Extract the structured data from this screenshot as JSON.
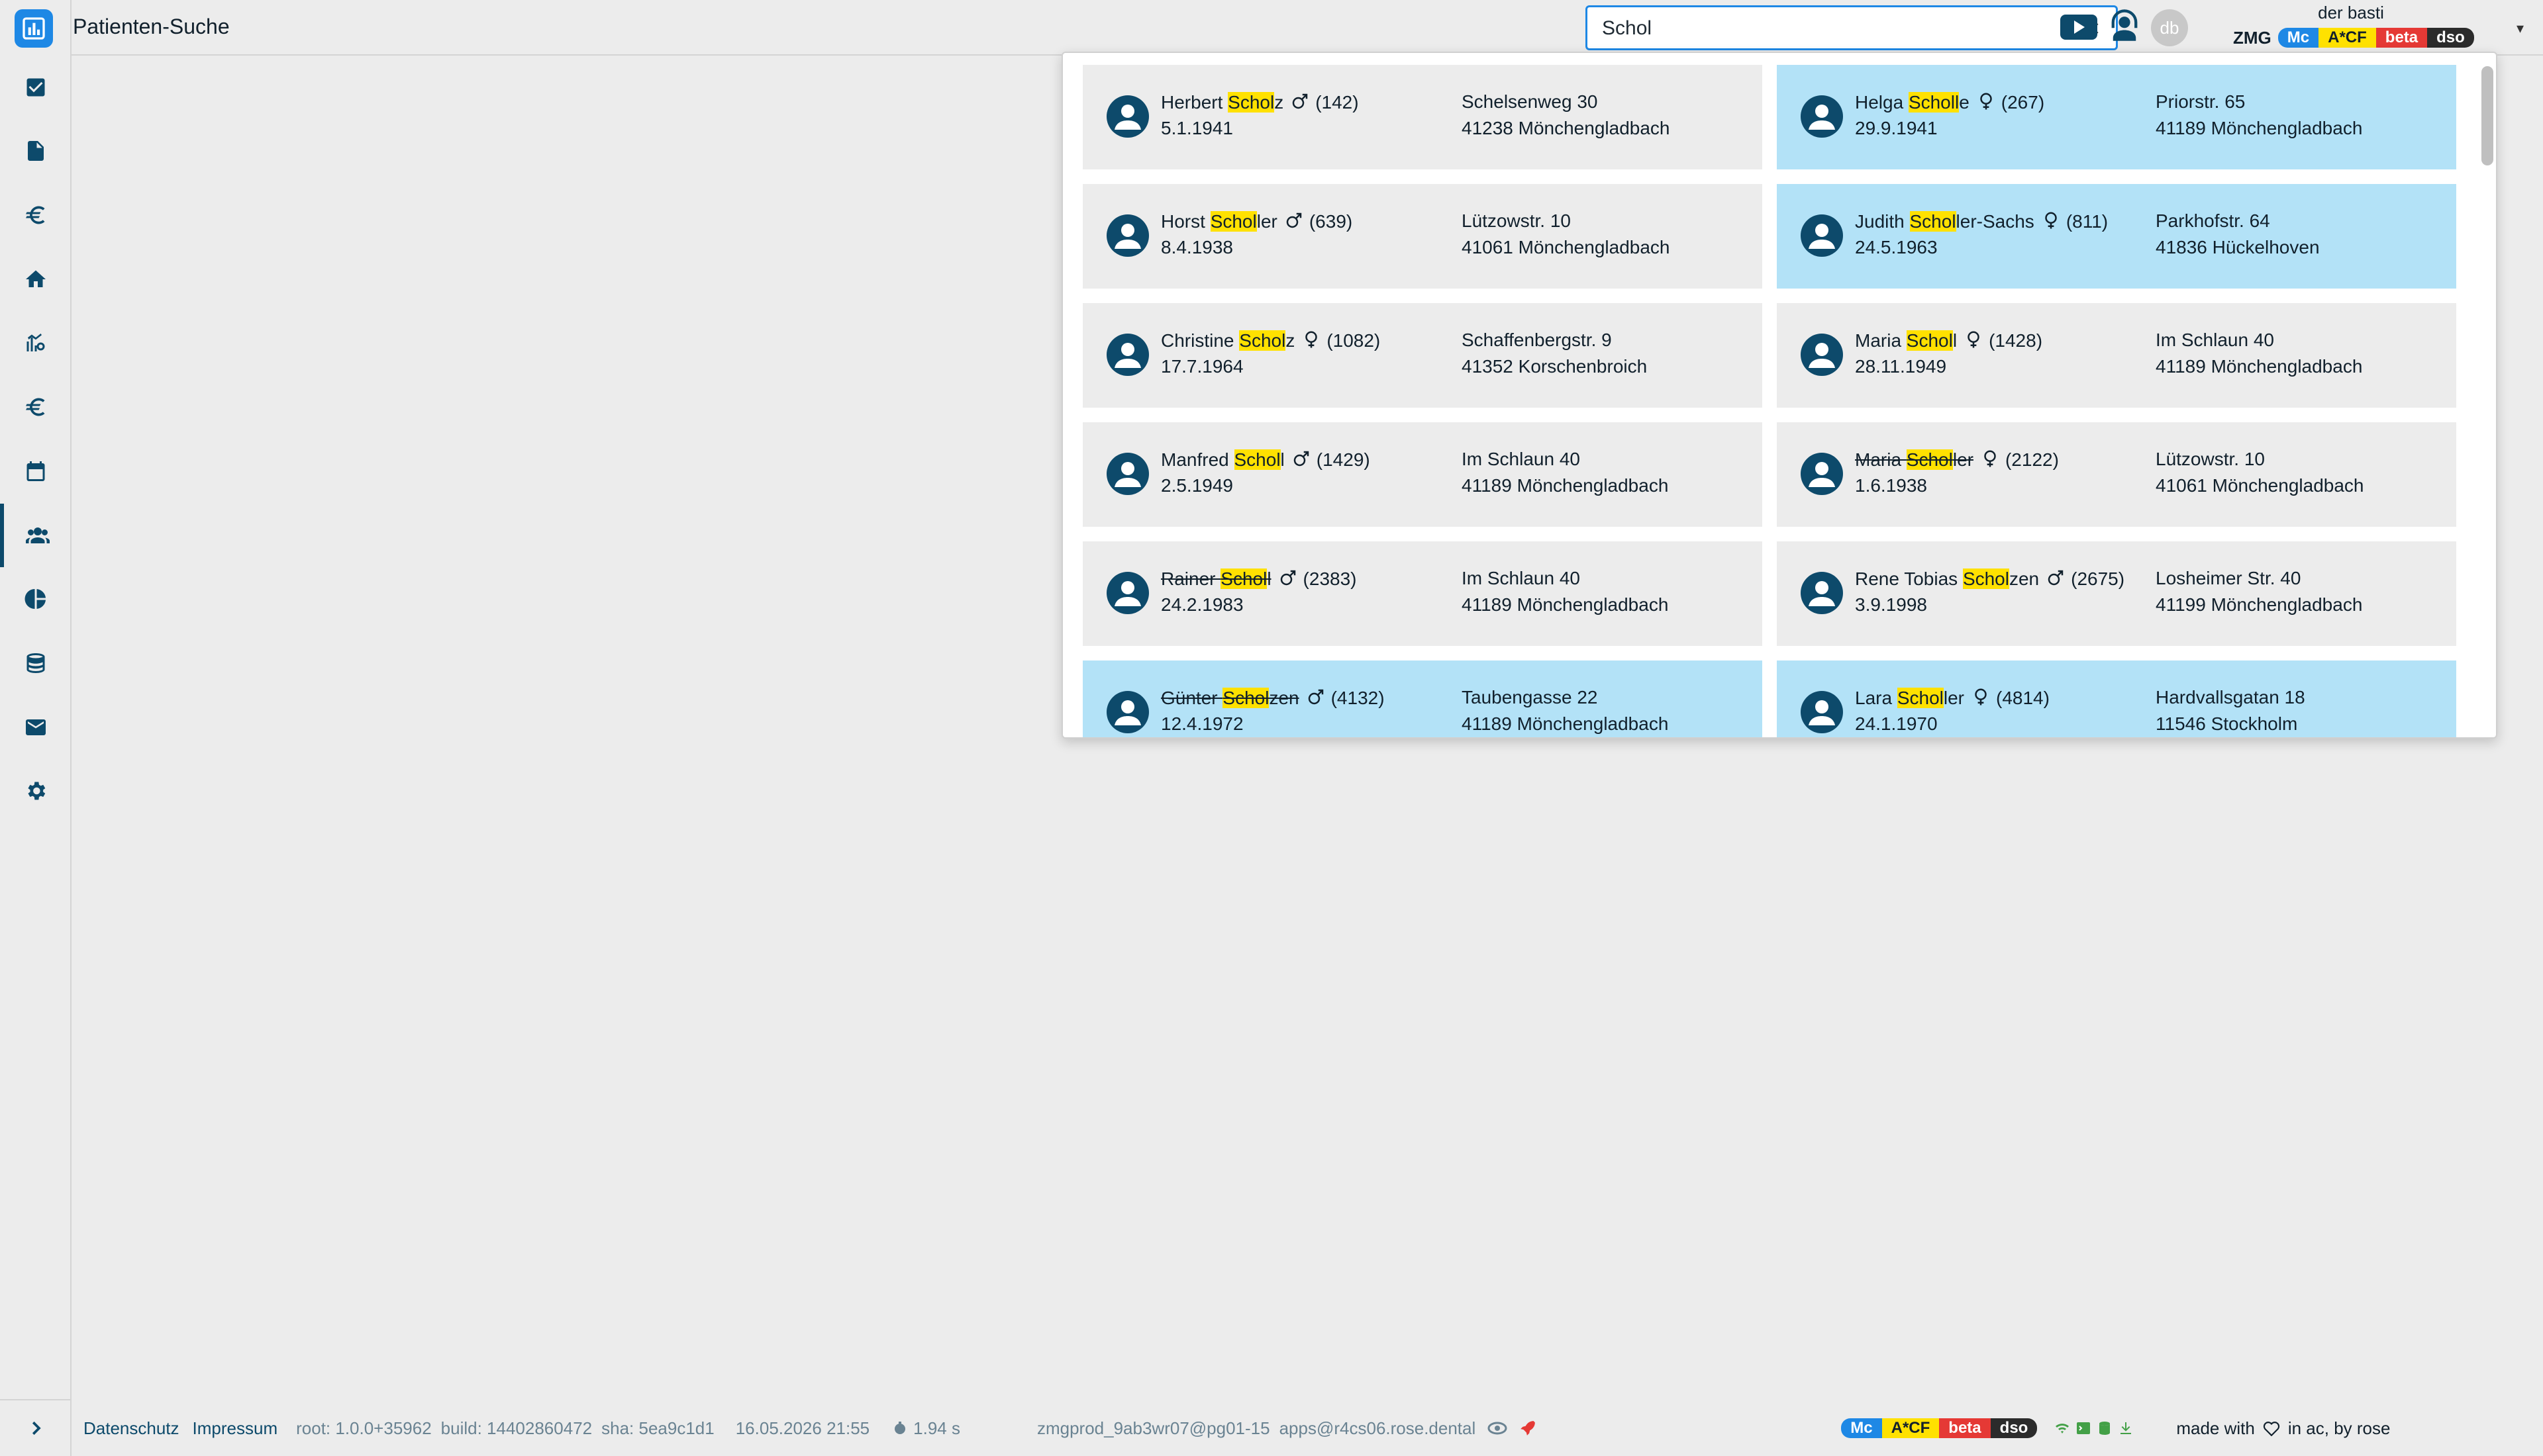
{
  "app": {
    "title": "Patienten-Suche"
  },
  "search": {
    "value": "Schol",
    "placeholder": "",
    "clear_icon": "×"
  },
  "user": {
    "name": "der basti",
    "avatar_initials": "db"
  },
  "badges": {
    "label": "ZMG",
    "items": [
      {
        "text": "Mc",
        "color": "#1e88e5"
      },
      {
        "text": "A*CF",
        "color": "#ffe100"
      },
      {
        "text": "beta",
        "color": "#e53935"
      },
      {
        "text": "dso",
        "color": "#2b2b2b"
      }
    ]
  },
  "sidebar": {
    "items": [
      {
        "icon": "checkbox-icon"
      },
      {
        "icon": "document-icon"
      },
      {
        "icon": "euro-icon"
      },
      {
        "icon": "home-icon"
      },
      {
        "icon": "chart-settings-icon"
      },
      {
        "icon": "euro-icon"
      },
      {
        "icon": "calendar-icon"
      },
      {
        "icon": "users-icon",
        "active": true
      },
      {
        "icon": "pie-chart-icon"
      },
      {
        "icon": "database-icon"
      },
      {
        "icon": "mail-icon"
      },
      {
        "icon": "gear-icon"
      }
    ]
  },
  "results": [
    {
      "first": "Herbert ",
      "match": "Schol",
      "rest": "z",
      "gender": "male",
      "id": "(142)",
      "dob": "5.1.1941",
      "street": "Schelsenweg 30",
      "city": "41238 Mönchengladbach",
      "highlight": false,
      "deleted": false
    },
    {
      "first": "Helga ",
      "match": "Scholl",
      "rest": "e",
      "gender": "female",
      "id": "(267)",
      "dob": "29.9.1941",
      "street": "Priorstr. 65",
      "city": "41189 Mönchengladbach",
      "highlight": true,
      "deleted": false
    },
    {
      "first": "Horst ",
      "match": "Schol",
      "rest": "ler",
      "gender": "male",
      "id": "(639)",
      "dob": "8.4.1938",
      "street": "Lützowstr. 10",
      "city": "41061 Mönchengladbach",
      "highlight": false,
      "deleted": false
    },
    {
      "first": "Judith ",
      "match": "Schol",
      "rest": "ler-Sachs",
      "gender": "female",
      "id": "(811)",
      "dob": "24.5.1963",
      "street": "Parkhofstr. 64",
      "city": "41836 Hückelhoven",
      "highlight": true,
      "deleted": false
    },
    {
      "first": "Christine ",
      "match": "Schol",
      "rest": "z",
      "gender": "female",
      "id": "(1082)",
      "dob": "17.7.1964",
      "street": "Schaffenbergstr. 9",
      "city": "41352 Korschenbroich",
      "highlight": false,
      "deleted": false
    },
    {
      "first": "Maria ",
      "match": "Schol",
      "rest": "l",
      "gender": "female",
      "id": "(1428)",
      "dob": "28.11.1949",
      "street": "Im Schlaun 40",
      "city": "41189 Mönchengladbach",
      "highlight": false,
      "deleted": false
    },
    {
      "first": "Manfred ",
      "match": "Schol",
      "rest": "l",
      "gender": "male",
      "id": "(1429)",
      "dob": "2.5.1949",
      "street": "Im Schlaun 40",
      "city": "41189 Mönchengladbach",
      "highlight": false,
      "deleted": false
    },
    {
      "first": "Maria ",
      "match": "Schol",
      "rest": "ler",
      "gender": "female",
      "id": "(2122)",
      "dob": "1.6.1938",
      "street": "Lützowstr. 10",
      "city": "41061 Mönchengladbach",
      "highlight": false,
      "deleted": true
    },
    {
      "first": "Rainer ",
      "match": "Schol",
      "rest": "l",
      "gender": "male",
      "id": "(2383)",
      "dob": "24.2.1983",
      "street": "Im Schlaun 40",
      "city": "41189 Mönchengladbach",
      "highlight": false,
      "deleted": true
    },
    {
      "first": "Rene Tobias ",
      "match": "Schol",
      "rest": "zen",
      "gender": "male",
      "id": "(2675)",
      "dob": "3.9.1998",
      "street": "Losheimer Str. 40",
      "city": "41199 Mönchengladbach",
      "highlight": false,
      "deleted": false
    },
    {
      "first": "Günter ",
      "match": "Schol",
      "rest": "zen",
      "gender": "male",
      "id": "(4132)",
      "dob": "12.4.1972",
      "street": "Taubengasse 22",
      "city": "41189 Mönchengladbach",
      "highlight": true,
      "deleted": true
    },
    {
      "first": "Lara ",
      "match": "Schol",
      "rest": "ler",
      "gender": "female",
      "id": "(4814)",
      "dob": "24.1.1970",
      "street": "Hardvallsgatan 18",
      "city": "11546 Stockholm",
      "highlight": true,
      "deleted": false
    }
  ],
  "footer": {
    "privacy": "Datenschutz",
    "imprint": "Impressum",
    "root": "root: 1.0.0+35962",
    "build": "build: 14402860472",
    "sha": "sha: 5ea9c1d1",
    "datetime": "16.05.2026 21:55",
    "timing": "1.94 s",
    "db": "zmgprod_9ab3wr07@pg01-15",
    "host": "apps@r4cs06.rose.dental",
    "made_with": "made with",
    "made_in": "in ac, by rose"
  }
}
